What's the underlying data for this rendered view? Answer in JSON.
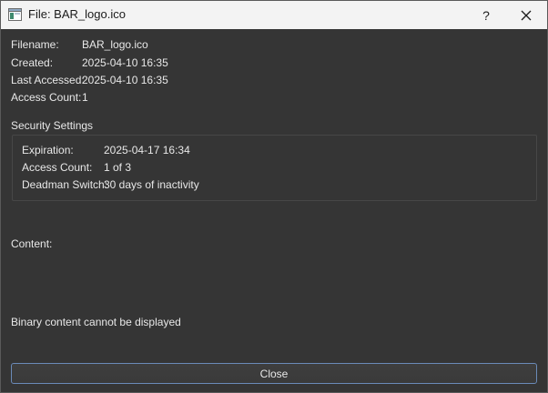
{
  "window": {
    "title": "File: BAR_logo.ico",
    "help_label": "?"
  },
  "info": {
    "filename_label": "Filename:",
    "filename_value": "BAR_logo.ico",
    "created_label": "Created:",
    "created_value": "2025-04-10 16:35",
    "last_accessed_label": "Last Accessed:",
    "last_accessed_value": "2025-04-10 16:35",
    "access_count_label": "Access Count:",
    "access_count_value": "1"
  },
  "security": {
    "heading": "Security Settings",
    "expiration_label": "Expiration:",
    "expiration_value": "2025-04-17 16:34",
    "access_count_label": "Access Count:",
    "access_count_value": "1 of 3",
    "deadman_label": "Deadman Switch:",
    "deadman_value": "30 days of inactivity"
  },
  "content": {
    "label": "Content:",
    "message": "Binary content cannot be displayed"
  },
  "buttons": {
    "close_label": "Close"
  },
  "colors": {
    "background": "#353535",
    "titlebar": "#f3f3f3",
    "button_focus_border": "#6a8ab8"
  }
}
